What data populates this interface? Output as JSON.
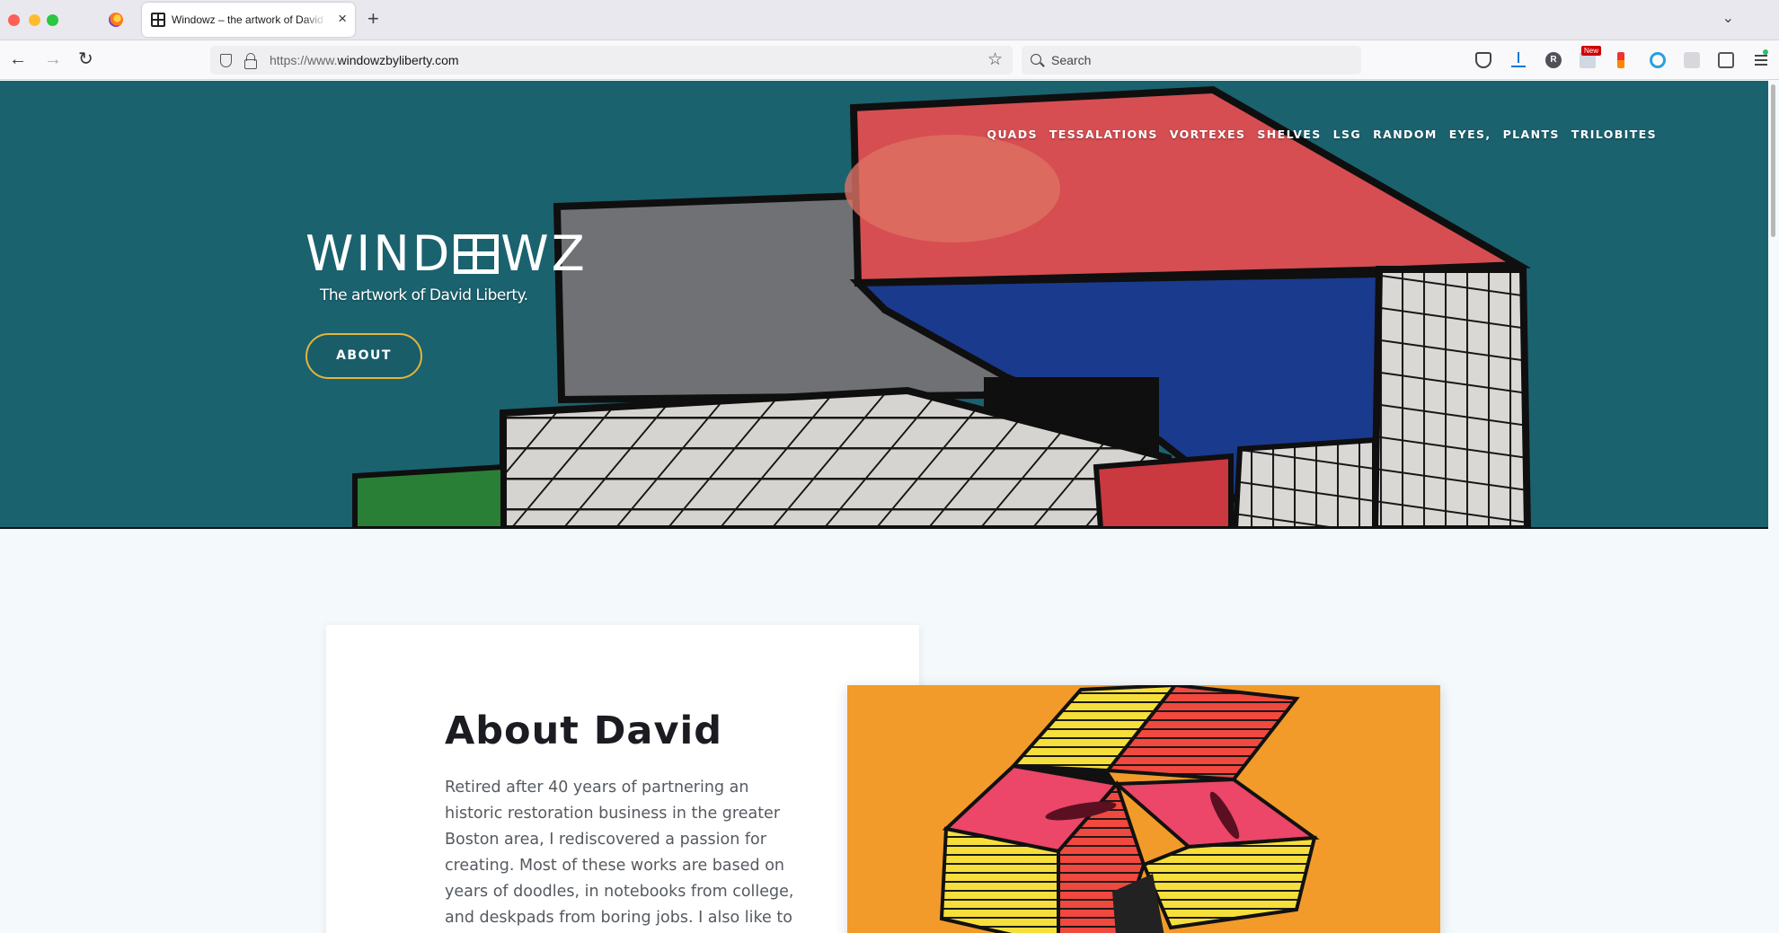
{
  "browser": {
    "tab_title": "Windowz – the artwork of David Liberty",
    "url_prefix": "https://www.",
    "url_domain": "windowzbyliberty.com",
    "search_placeholder": "Search",
    "profile_initial": "R",
    "new_badge": "New"
  },
  "site": {
    "nav": [
      "QUADS",
      "TESSALATIONS",
      "VORTEXES",
      "SHELVES",
      "LSG",
      "RANDOM",
      "EYES,",
      "PLANTS",
      "TRILOBITES"
    ],
    "logo_left": "WIND",
    "logo_right": "WZ",
    "tagline": "The artwork of David Liberty.",
    "about_button": "ABOUT"
  },
  "about": {
    "heading": "About David",
    "body": "Retired after 40 years of partnering an historic restoration business in the greater Boston area, I rediscovered a passion for creating. Most of these works are based on years of doodles, in notebooks from college, and deskpads from boring jobs. I also like to use photos I've taken,"
  },
  "colors": {
    "hero_teal": "#1e6b79",
    "button_border": "#e6b43b",
    "art_orange": "#f29b2a"
  }
}
